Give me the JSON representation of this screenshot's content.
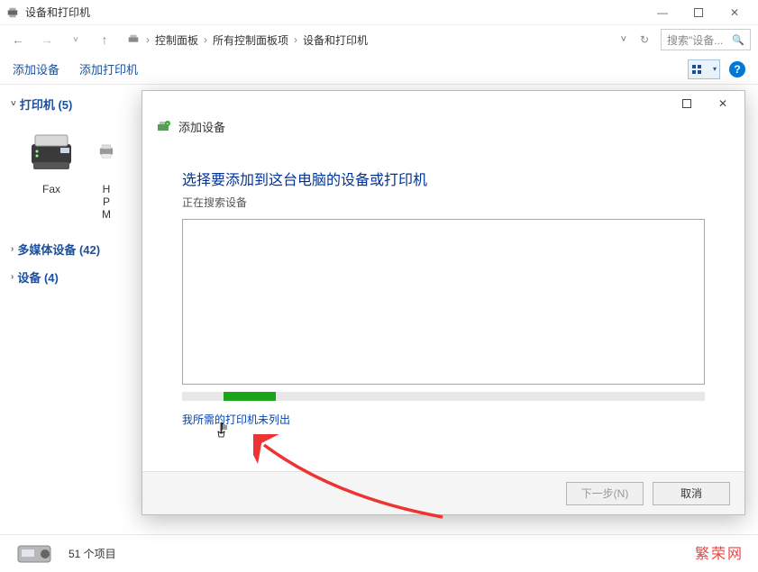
{
  "window": {
    "title": "设备和打印机",
    "minimize": "—",
    "maximize": "▢",
    "close": "✕"
  },
  "nav": {
    "back": "←",
    "forward": "→",
    "up": "↑",
    "refresh": "⟳",
    "dropdown": "v"
  },
  "breadcrumb": {
    "root_icon": "🖶",
    "items": [
      "控制面板",
      "所有控制面板项",
      "设备和打印机"
    ]
  },
  "search": {
    "placeholder": "搜索\"设备..."
  },
  "toolbar": {
    "add_device": "添加设备",
    "add_printer": "添加打印机",
    "help": "?"
  },
  "groups": [
    {
      "label": "打印机 (5)",
      "expanded": true
    },
    {
      "label": "多媒体设备 (42)",
      "expanded": false
    },
    {
      "label": "设备 (4)",
      "expanded": false
    }
  ],
  "printers": [
    {
      "name": "Fax"
    },
    {
      "name": "H\nP\nM"
    }
  ],
  "status": {
    "text": "51 个项目"
  },
  "dialog": {
    "title": "添加设备",
    "heading": "选择要添加到这台电脑的设备或打印机",
    "searching": "正在搜索设备",
    "not_listed": "我所需的打印机未列出",
    "next": "下一步(N)",
    "cancel": "取消"
  },
  "watermark": "繁荣网"
}
